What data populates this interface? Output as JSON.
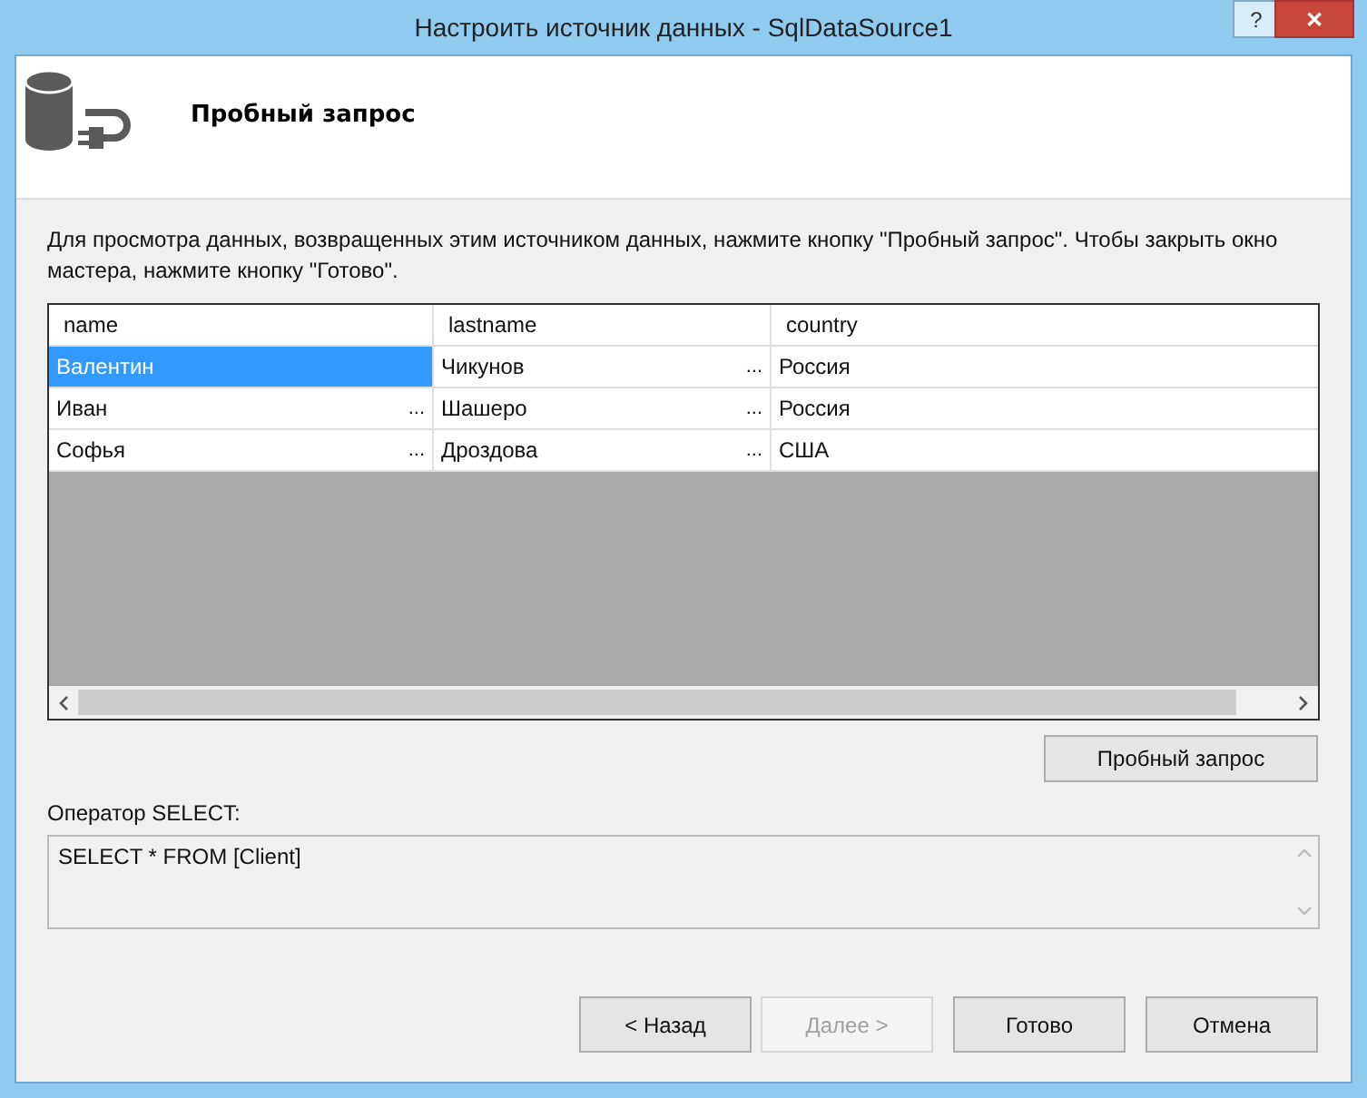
{
  "window": {
    "title": "Настроить источник данных - SqlDataSource1",
    "help": "?",
    "close": "✕"
  },
  "header": {
    "title": "Пробный запрос"
  },
  "description": "Для просмотра данных, возвращенных этим источником данных, нажмите кнопку \"Пробный запрос\". Чтобы закрыть окно мастера, нажмите кнопку \"Готово\".",
  "table": {
    "columns": [
      "name",
      "lastname",
      "country"
    ],
    "rows": [
      {
        "cells": [
          {
            "text": "Валентин",
            "selected": true
          },
          {
            "text": "Чикунов",
            "ellipsis": "...",
            "selected": false
          },
          {
            "text": "Россия",
            "selected": false
          }
        ]
      },
      {
        "cells": [
          {
            "text": "Иван",
            "ellipsis": "...",
            "selected": false
          },
          {
            "text": "Шашеро",
            "ellipsis": "...",
            "selected": false
          },
          {
            "text": "Россия",
            "selected": false
          }
        ]
      },
      {
        "cells": [
          {
            "text": "Софья",
            "ellipsis": "...",
            "selected": false
          },
          {
            "text": "Дроздова",
            "ellipsis": "...",
            "selected": false
          },
          {
            "text": "США",
            "selected": false
          }
        ]
      }
    ]
  },
  "test_button": "Пробный запрос",
  "select_label": "Оператор SELECT:",
  "select_text": "SELECT * FROM [Client]",
  "buttons": [
    {
      "label": "< Назад",
      "disabled": false
    },
    {
      "label": "Далее >",
      "disabled": true
    },
    {
      "label": "Готово",
      "disabled": false
    },
    {
      "label": "Отмена",
      "disabled": false
    }
  ]
}
